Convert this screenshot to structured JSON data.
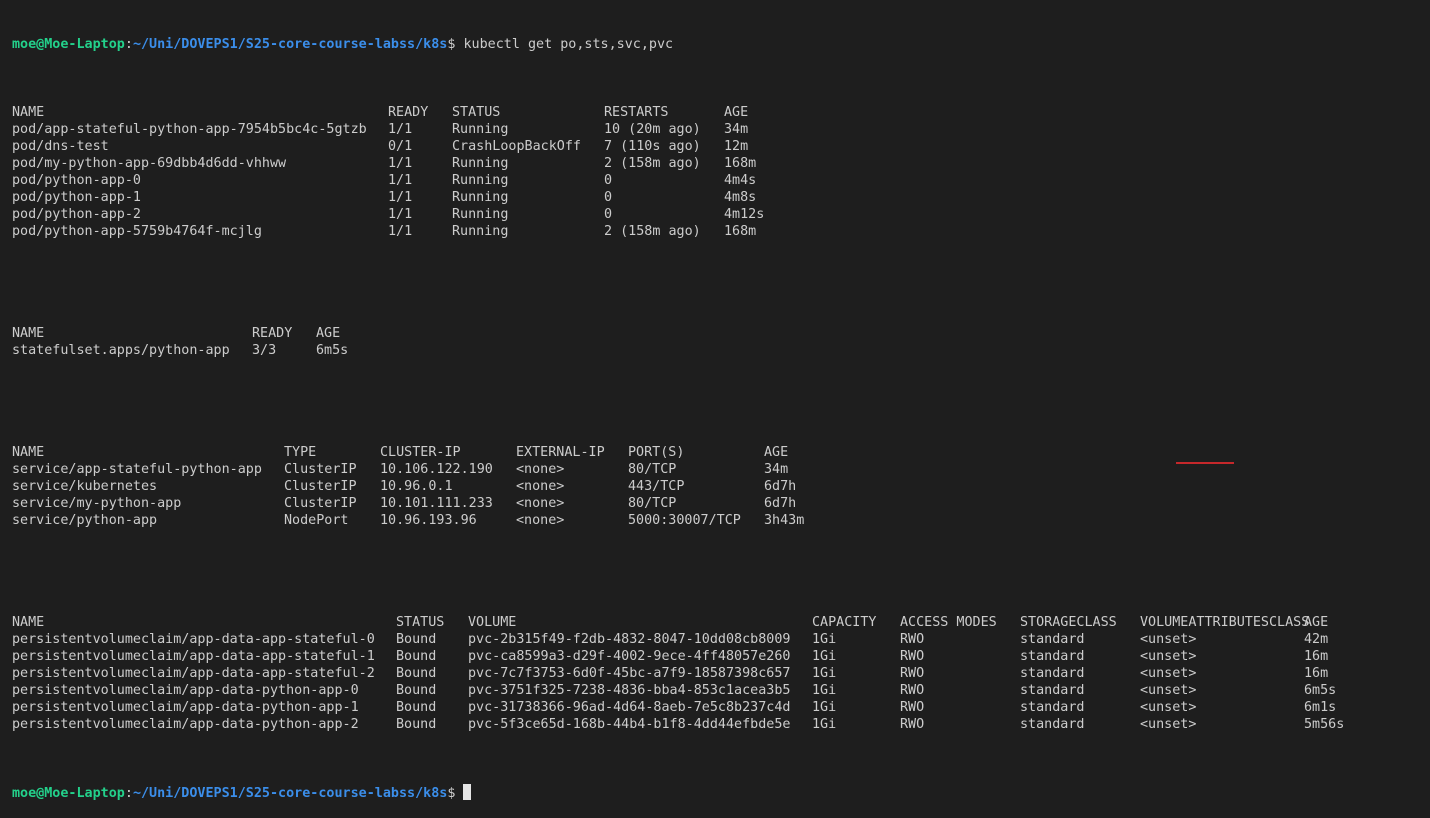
{
  "prompt": {
    "user_host": "moe@Moe-Laptop",
    "separator": ":",
    "path": "~/Uni/DOVEPS1/S25-core-course-labss/k8s",
    "symbol": "$",
    "command": " kubectl get po,sts,svc,pvc"
  },
  "pods": {
    "headers": [
      "NAME",
      "READY",
      "STATUS",
      "RESTARTS",
      "AGE"
    ],
    "rows": [
      [
        "pod/app-stateful-python-app-7954b5bc4c-5gtzb",
        "1/1",
        "Running",
        "10 (20m ago)",
        "34m"
      ],
      [
        "pod/dns-test",
        "0/1",
        "CrashLoopBackOff",
        "7 (110s ago)",
        "12m"
      ],
      [
        "pod/my-python-app-69dbb4d6dd-vhhww",
        "1/1",
        "Running",
        "2 (158m ago)",
        "168m"
      ],
      [
        "pod/python-app-0",
        "1/1",
        "Running",
        "0",
        "4m4s"
      ],
      [
        "pod/python-app-1",
        "1/1",
        "Running",
        "0",
        "4m8s"
      ],
      [
        "pod/python-app-2",
        "1/1",
        "Running",
        "0",
        "4m12s"
      ],
      [
        "pod/python-app-5759b4764f-mcjlg",
        "1/1",
        "Running",
        "2 (158m ago)",
        "168m"
      ]
    ]
  },
  "statefulsets": {
    "headers": [
      "NAME",
      "READY",
      "AGE"
    ],
    "rows": [
      [
        "statefulset.apps/python-app",
        "3/3",
        "6m5s"
      ]
    ]
  },
  "services": {
    "headers": [
      "NAME",
      "TYPE",
      "CLUSTER-IP",
      "EXTERNAL-IP",
      "PORT(S)",
      "AGE"
    ],
    "rows": [
      [
        "service/app-stateful-python-app",
        "ClusterIP",
        "10.106.122.190",
        "<none>",
        "80/TCP",
        "34m"
      ],
      [
        "service/kubernetes",
        "ClusterIP",
        "10.96.0.1",
        "<none>",
        "443/TCP",
        "6d7h"
      ],
      [
        "service/my-python-app",
        "ClusterIP",
        "10.101.111.233",
        "<none>",
        "80/TCP",
        "6d7h"
      ],
      [
        "service/python-app",
        "NodePort",
        "10.96.193.96",
        "<none>",
        "5000:30007/TCP",
        "3h43m"
      ]
    ]
  },
  "pvcs": {
    "headers": [
      "NAME",
      "STATUS",
      "VOLUME",
      "CAPACITY",
      "ACCESS MODES",
      "STORAGECLASS",
      "VOLUMEATTRIBUTESCLASS",
      "AGE"
    ],
    "rows": [
      [
        "persistentvolumeclaim/app-data-app-stateful-0",
        "Bound",
        "pvc-2b315f49-f2db-4832-8047-10dd08cb8009",
        "1Gi",
        "RWO",
        "standard",
        "<unset>",
        "42m"
      ],
      [
        "persistentvolumeclaim/app-data-app-stateful-1",
        "Bound",
        "pvc-ca8599a3-d29f-4002-9ece-4ff48057e260",
        "1Gi",
        "RWO",
        "standard",
        "<unset>",
        "16m"
      ],
      [
        "persistentvolumeclaim/app-data-app-stateful-2",
        "Bound",
        "pvc-7c7f3753-6d0f-45bc-a7f9-18587398c657",
        "1Gi",
        "RWO",
        "standard",
        "<unset>",
        "16m"
      ],
      [
        "persistentvolumeclaim/app-data-python-app-0",
        "Bound",
        "pvc-3751f325-7238-4836-bba4-853c1acea3b5",
        "1Gi",
        "RWO",
        "standard",
        "<unset>",
        "6m5s"
      ],
      [
        "persistentvolumeclaim/app-data-python-app-1",
        "Bound",
        "pvc-31738366-96ad-4d64-8aeb-7e5c8b237c4d",
        "1Gi",
        "RWO",
        "standard",
        "<unset>",
        "6m1s"
      ],
      [
        "persistentvolumeclaim/app-data-python-app-2",
        "Bound",
        "pvc-5f3ce65d-168b-44b4-b1f8-4dd44efbde5e",
        "1Gi",
        "RWO",
        "standard",
        "<unset>",
        "5m56s"
      ]
    ]
  },
  "colors": {
    "background": "#1e1e1e",
    "foreground": "#cccccc",
    "prompt_user": "#23d18b",
    "prompt_path": "#3b8eea"
  }
}
